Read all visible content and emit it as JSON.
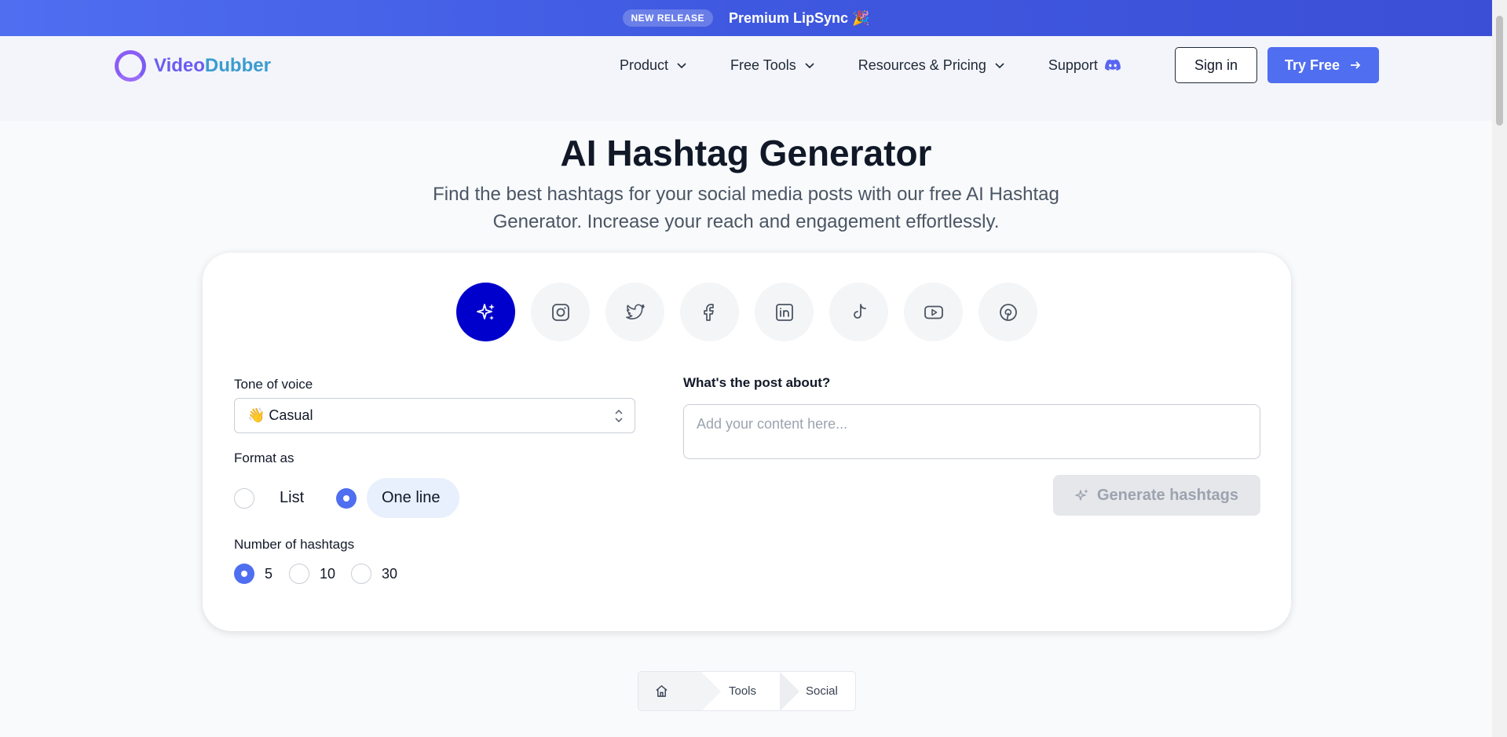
{
  "banner": {
    "badge": "NEW RELEASE",
    "text": "Premium LipSync 🎉"
  },
  "header": {
    "logo": {
      "part1": "Video",
      "part2": "Dubber"
    },
    "nav": [
      {
        "label": "Product",
        "icon": "chevron-down-icon"
      },
      {
        "label": "Free Tools",
        "icon": "chevron-down-icon"
      },
      {
        "label": "Resources & Pricing",
        "icon": "chevron-down-icon"
      },
      {
        "label": "Support",
        "icon": "discord-icon"
      }
    ],
    "sign_in": "Sign in",
    "try_free": "Try Free"
  },
  "hero": {
    "title": "AI Hashtag Generator",
    "subtitle": "Find the best hashtags for your social media posts with our free AI Hashtag Generator. Increase your reach and engagement effortlessly."
  },
  "tool": {
    "platforms": [
      "sparkles-icon",
      "instagram-icon",
      "twitter-icon",
      "facebook-icon",
      "linkedin-icon",
      "tiktok-icon",
      "youtube-icon",
      "pinterest-icon"
    ],
    "active_platform": "sparkles-icon",
    "tone_label": "Tone of voice",
    "tone_value": "👋 Casual",
    "format_label": "Format as",
    "format_options": [
      "List",
      "One line"
    ],
    "format_selected": "One line",
    "count_label": "Number of hashtags",
    "count_options": [
      "5",
      "10",
      "30"
    ],
    "count_selected": "5",
    "post_label": "What's the post about?",
    "post_placeholder": "Add your content here...",
    "post_value": "",
    "generate_label": "Generate hashtags"
  },
  "breadcrumb": {
    "items": [
      "Tools",
      "Social"
    ]
  },
  "colors": {
    "brand": "#4f6ef0",
    "active_platform": "#0000cc",
    "logo_purple": "#8b5cf6"
  }
}
